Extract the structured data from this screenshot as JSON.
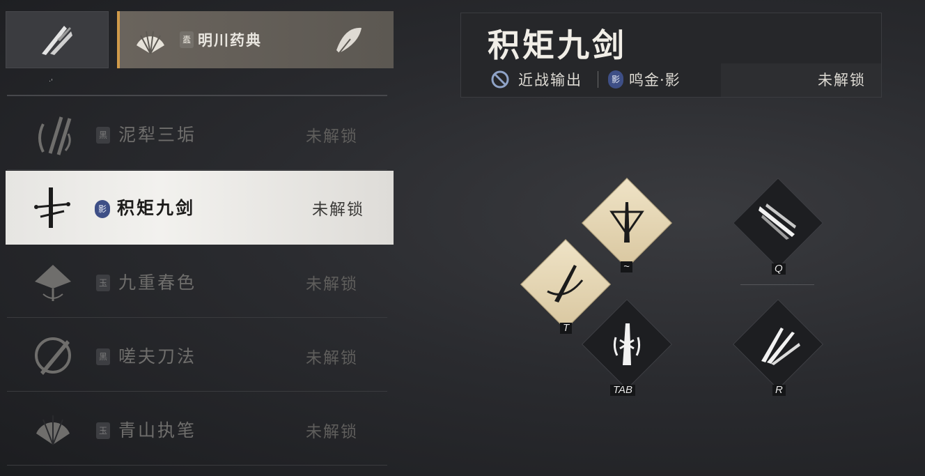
{
  "top_tab": {
    "title": "明川药典",
    "badge": "蠹"
  },
  "top_dot": "·'",
  "list": [
    {
      "name": "泥犁三垢",
      "status": "未解锁",
      "badge": "黑",
      "badge_style": "square",
      "icon": "triple-slash-icon",
      "selected": false
    },
    {
      "name": "积矩九剑",
      "status": "未解锁",
      "badge": "影",
      "badge_style": "round",
      "icon": "sword-cross-icon",
      "selected": true
    },
    {
      "name": "九重春色",
      "status": "未解锁",
      "badge": "玉",
      "badge_style": "square",
      "icon": "umbrella-icon",
      "selected": false
    },
    {
      "name": "嗟夫刀法",
      "status": "未解锁",
      "badge": "黑",
      "badge_style": "square",
      "icon": "circle-blade-icon",
      "selected": false
    },
    {
      "name": "青山执笔",
      "status": "未解锁",
      "badge": "玉",
      "badge_style": "square",
      "icon": "fan-icon",
      "selected": false
    }
  ],
  "info": {
    "title": "积矩九剑",
    "tag1": "近战输出",
    "tag2_badge": "影",
    "tag2": "鸣金·影",
    "status": "未解锁"
  },
  "skills": [
    {
      "key": "~",
      "style": "light",
      "icon": "triangle-sword-icon"
    },
    {
      "key": "T",
      "style": "light",
      "icon": "sword-slash-icon"
    },
    {
      "key": "TAB",
      "style": "dark",
      "icon": "warrior-icon"
    },
    {
      "key": "Q",
      "style": "dark",
      "icon": "dash-strike-icon"
    },
    {
      "key": "R",
      "style": "dark",
      "icon": "multi-blade-icon"
    }
  ],
  "colors": {
    "accent": "#d09a4a",
    "badge_blue": "#3e4f86",
    "light_tile": "#efe3c6"
  }
}
